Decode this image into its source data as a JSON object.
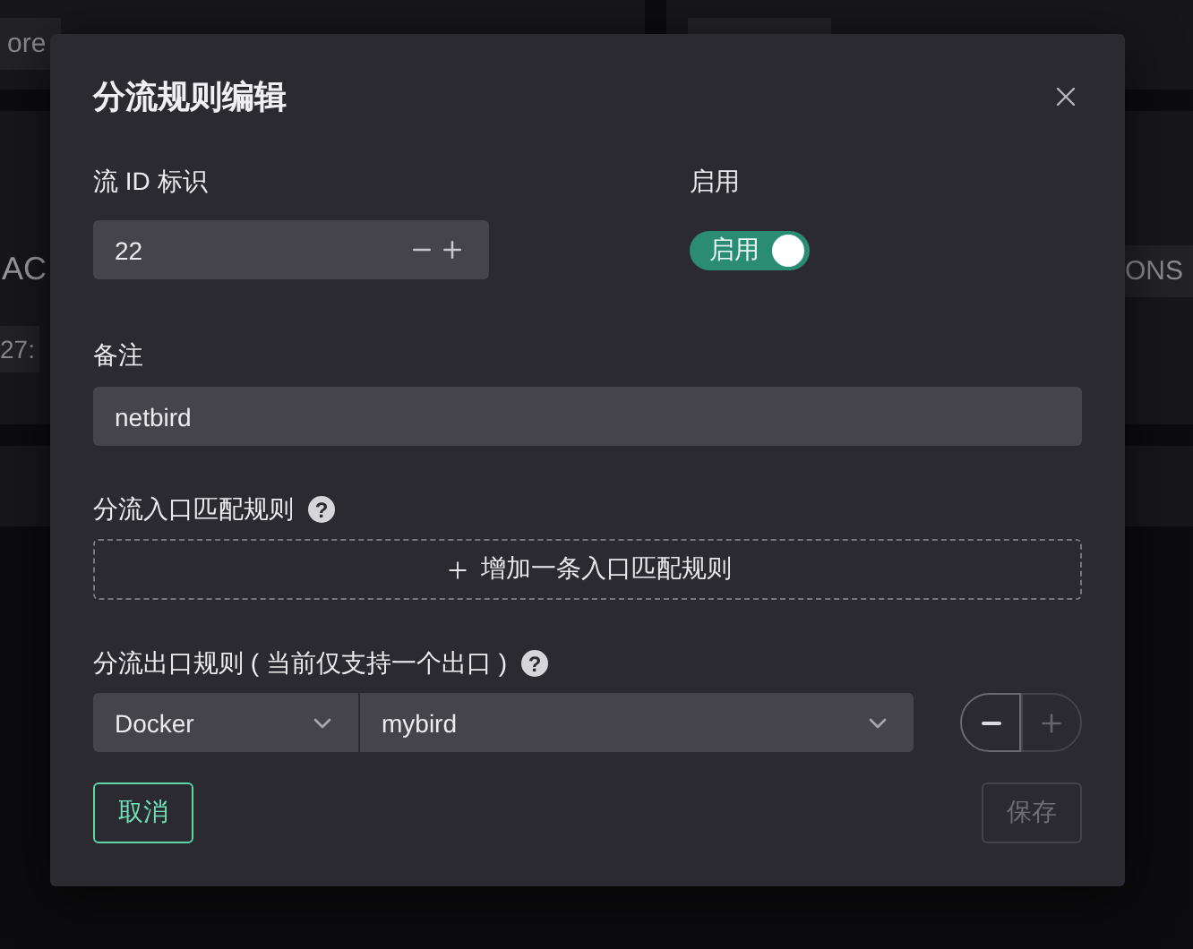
{
  "background": {
    "fragments": [
      {
        "text": "ore"
      },
      {
        "text": "AC"
      },
      {
        "text": "27:"
      },
      {
        "text": "ONS"
      }
    ]
  },
  "dialog": {
    "title": "分流规则编辑",
    "flow_id": {
      "label": "流 ID 标识",
      "value": "22"
    },
    "enable": {
      "label": "启用",
      "toggle_text": "启用",
      "on": true
    },
    "note": {
      "label": "备注",
      "value": "netbird"
    },
    "entry_rules": {
      "label": "分流入口匹配规则",
      "help": "?",
      "add_button": "增加一条入口匹配规则"
    },
    "exit_rules": {
      "label": "分流出口规则 ( 当前仅支持一个出口 )",
      "help": "?",
      "type": "Docker",
      "target": "mybird",
      "remove_disabled": false,
      "add_disabled": true
    },
    "buttons": [
      {
        "label": "取消",
        "kind": "outline",
        "disabled": false
      },
      {
        "label": "保存",
        "kind": "primary",
        "disabled": true
      }
    ]
  }
}
